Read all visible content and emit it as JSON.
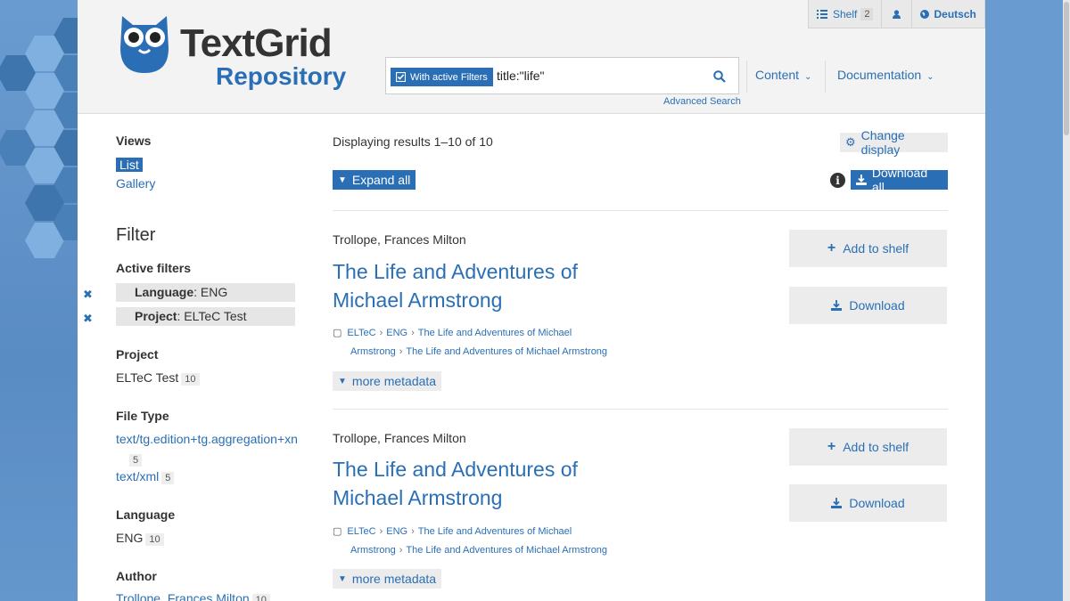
{
  "colors": {
    "accent": "#2a6fb5",
    "header_bg": "#f3f3f3",
    "button_bg": "#ececec"
  },
  "logo": {
    "title": "TextGrid",
    "subtitle": "Repository"
  },
  "topbar": {
    "shelf_label": "Shelf",
    "shelf_count": "2",
    "user_icon": "user-icon",
    "language_label": "Deutsch"
  },
  "search": {
    "filter_button": "With active Filters",
    "query": "title:\"life\"",
    "advanced_link": "Advanced Search"
  },
  "nav": {
    "content": "Content",
    "documentation": "Documentation"
  },
  "sidebar": {
    "views_title": "Views",
    "view_list": "List",
    "view_gallery": "Gallery",
    "filter_heading": "Filter",
    "active_filters_title": "Active filters",
    "active_filters": [
      {
        "key": "Language",
        "value": "ENG"
      },
      {
        "key": "Project",
        "value": "ELTeC Test"
      }
    ],
    "project_title": "Project",
    "project_value": "ELTeC Test",
    "project_count": "10",
    "filetype_title": "File Type",
    "filetype_1": "text/tg.edition+tg.aggregation+xn",
    "filetype_1_count": "5",
    "filetype_2": "text/xml",
    "filetype_2_count": "5",
    "language_title": "Language",
    "language_value": "ENG",
    "language_count": "10",
    "author_title": "Author",
    "author_value": "Trollope, Frances Milton",
    "author_count": "10"
  },
  "main": {
    "results_text": "Displaying results 1–10 of 10",
    "change_display": "Change display",
    "expand_all": "Expand all",
    "download_all": "Download all",
    "add_to_shelf": "Add to shelf",
    "download": "Download",
    "more_metadata": "more metadata",
    "results": [
      {
        "author": "Trollope, Frances Milton",
        "title_line1": "The Life and Adventures of",
        "title_line2": "Michael Armstrong",
        "crumb_1": "ELTeC",
        "crumb_2": "ENG",
        "crumb_3a": "The Life and Adventures of Michael",
        "crumb_3b": "Armstrong",
        "crumb_4": "The Life and Adventures of Michael Armstrong"
      },
      {
        "author": "Trollope, Frances Milton",
        "title_line1": "The Life and Adventures of",
        "title_line2": "Michael Armstrong",
        "crumb_1": "ELTeC",
        "crumb_2": "ENG",
        "crumb_3a": "The Life and Adventures of Michael",
        "crumb_3b": "Armstrong",
        "crumb_4": "The Life and Adventures of Michael Armstrong"
      }
    ]
  }
}
